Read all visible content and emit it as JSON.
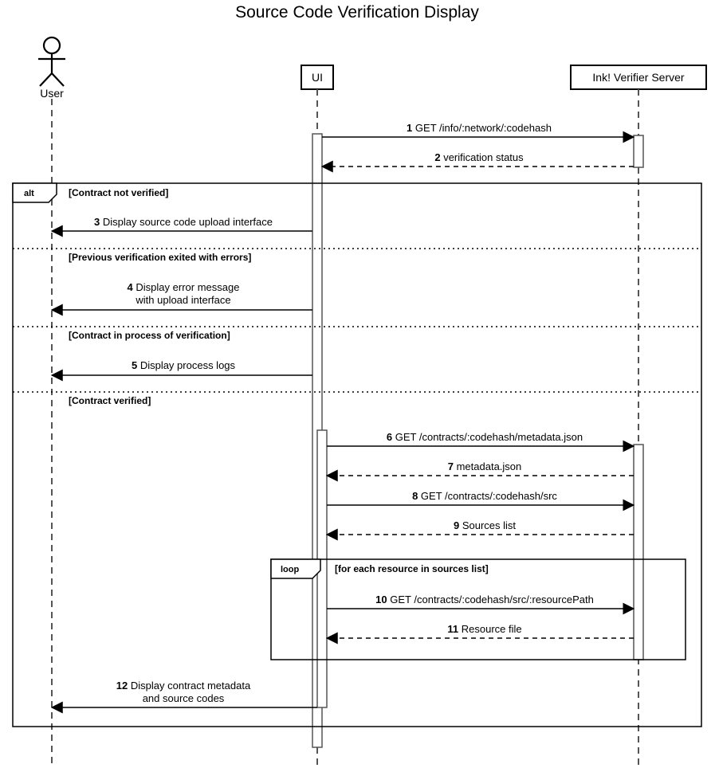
{
  "title": "Source Code Verification Display",
  "actors": {
    "user": "User",
    "ui": "UI",
    "server": "Ink! Verifier Server"
  },
  "fragments": {
    "alt": "alt",
    "loop": "loop",
    "loop_cond": "[for each resource in sources list]"
  },
  "conditions": {
    "c1": "[Contract not verified]",
    "c2": "[Previous verification exited with errors]",
    "c3": "[Contract in process of verification]",
    "c4": "[Contract verified]"
  },
  "messages": {
    "m1": {
      "n": "1",
      "t": "GET /info/:network/:codehash"
    },
    "m2": {
      "n": "2",
      "t": "verification status"
    },
    "m3": {
      "n": "3",
      "t": "Display source code upload interface"
    },
    "m4a": {
      "n": "4",
      "t": "Display error message"
    },
    "m4b": {
      "t": "with upload interface"
    },
    "m5": {
      "n": "5",
      "t": "Display process logs"
    },
    "m6": {
      "n": "6",
      "t": "GET /contracts/:codehash/metadata.json"
    },
    "m7": {
      "n": "7",
      "t": "metadata.json"
    },
    "m8": {
      "n": "8",
      "t": "GET /contracts/:codehash/src"
    },
    "m9": {
      "n": "9",
      "t": "Sources list"
    },
    "m10": {
      "n": "10",
      "t": "GET /contracts/:codehash/src/:resourcePath"
    },
    "m11": {
      "n": "11",
      "t": "Resource file"
    },
    "m12a": {
      "n": "12",
      "t": "Display contract metadata"
    },
    "m12b": {
      "t": "and source codes"
    }
  }
}
